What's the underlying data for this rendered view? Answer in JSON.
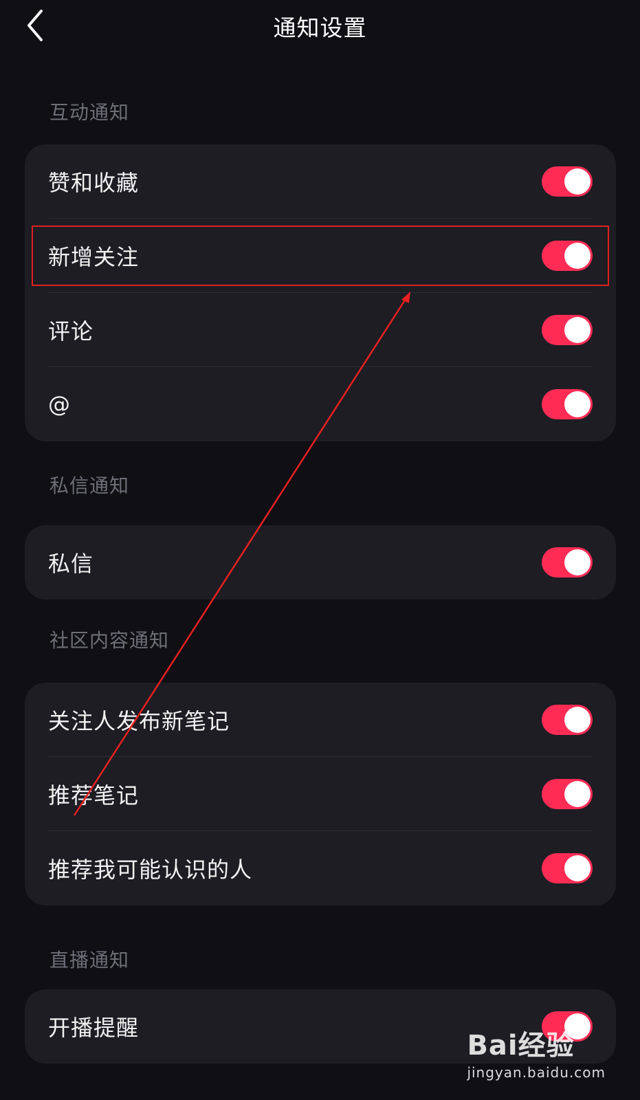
{
  "header": {
    "title": "通知设置",
    "back_icon": "chevron-left-icon"
  },
  "accent_color": "#fe2c55",
  "sections": [
    {
      "title": "互动通知",
      "items": [
        {
          "label": "赞和收藏",
          "enabled": true
        },
        {
          "label": "新增关注",
          "enabled": true
        },
        {
          "label": "评论",
          "enabled": true
        },
        {
          "label": "@",
          "enabled": true
        }
      ]
    },
    {
      "title": "私信通知",
      "items": [
        {
          "label": "私信",
          "enabled": true
        }
      ]
    },
    {
      "title": "社区内容通知",
      "items": [
        {
          "label": "关注人发布新笔记",
          "enabled": true
        },
        {
          "label": "推荐笔记",
          "enabled": true
        },
        {
          "label": "推荐我可能认识的人",
          "enabled": true
        }
      ]
    },
    {
      "title": "直播通知",
      "items": [
        {
          "label": "开播提醒",
          "enabled": true
        }
      ]
    }
  ],
  "watermark": {
    "logo": "Bai经验",
    "url": "jingyan.baidu.com"
  }
}
